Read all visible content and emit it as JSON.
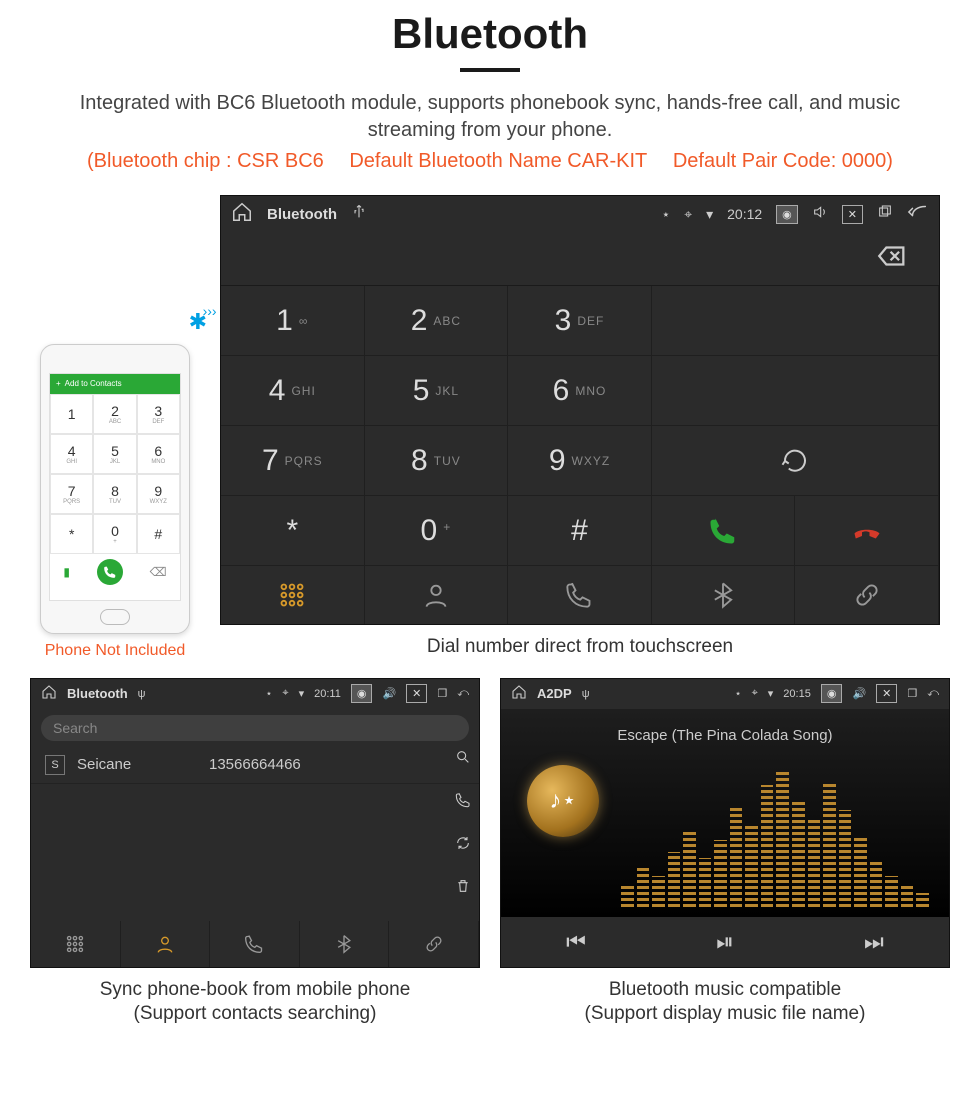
{
  "title": "Bluetooth",
  "intro": "Integrated with BC6 Bluetooth module, supports phonebook sync, hands-free call, and music streaming from your phone.",
  "spec": {
    "chip": "(Bluetooth chip : CSR BC6",
    "name": "Default Bluetooth Name CAR-KIT",
    "pair": "Default Pair Code: 0000)"
  },
  "phone": {
    "caption": "Phone Not Included",
    "top_label": "Add to Contacts",
    "keys": [
      {
        "n": "1",
        "s": ""
      },
      {
        "n": "2",
        "s": "ABC"
      },
      {
        "n": "3",
        "s": "DEF"
      },
      {
        "n": "4",
        "s": "GHI"
      },
      {
        "n": "5",
        "s": "JKL"
      },
      {
        "n": "6",
        "s": "MNO"
      },
      {
        "n": "7",
        "s": "PQRS"
      },
      {
        "n": "8",
        "s": "TUV"
      },
      {
        "n": "9",
        "s": "WXYZ"
      },
      {
        "n": "*",
        "s": ""
      },
      {
        "n": "0",
        "s": "+"
      },
      {
        "n": "#",
        "s": ""
      }
    ]
  },
  "dialer": {
    "statusbar": {
      "title": "Bluetooth",
      "time": "20:12"
    },
    "keys": [
      {
        "n": "1",
        "s": "∞"
      },
      {
        "n": "2",
        "s": "ABC"
      },
      {
        "n": "3",
        "s": "DEF"
      },
      {
        "n": "4",
        "s": "GHI"
      },
      {
        "n": "5",
        "s": "JKL"
      },
      {
        "n": "6",
        "s": "MNO"
      },
      {
        "n": "7",
        "s": "PQRS"
      },
      {
        "n": "8",
        "s": "TUV"
      },
      {
        "n": "9",
        "s": "WXYZ"
      },
      {
        "n": "*",
        "s": ""
      },
      {
        "n": "0",
        "s": "+"
      },
      {
        "n": "#",
        "s": ""
      }
    ],
    "caption": "Dial number direct from touchscreen"
  },
  "contacts": {
    "statusbar": {
      "title": "Bluetooth",
      "time": "20:11"
    },
    "search_placeholder": "Search",
    "row": {
      "badge": "S",
      "name": "Seicane",
      "number": "13566664466"
    },
    "caption_l1": "Sync phone-book from mobile phone",
    "caption_l2": "(Support contacts searching)"
  },
  "music": {
    "statusbar": {
      "title": "A2DP",
      "time": "20:15"
    },
    "song": "Escape (The Pina Colada Song)",
    "caption_l1": "Bluetooth music compatible",
    "caption_l2": "(Support display music file name)"
  }
}
